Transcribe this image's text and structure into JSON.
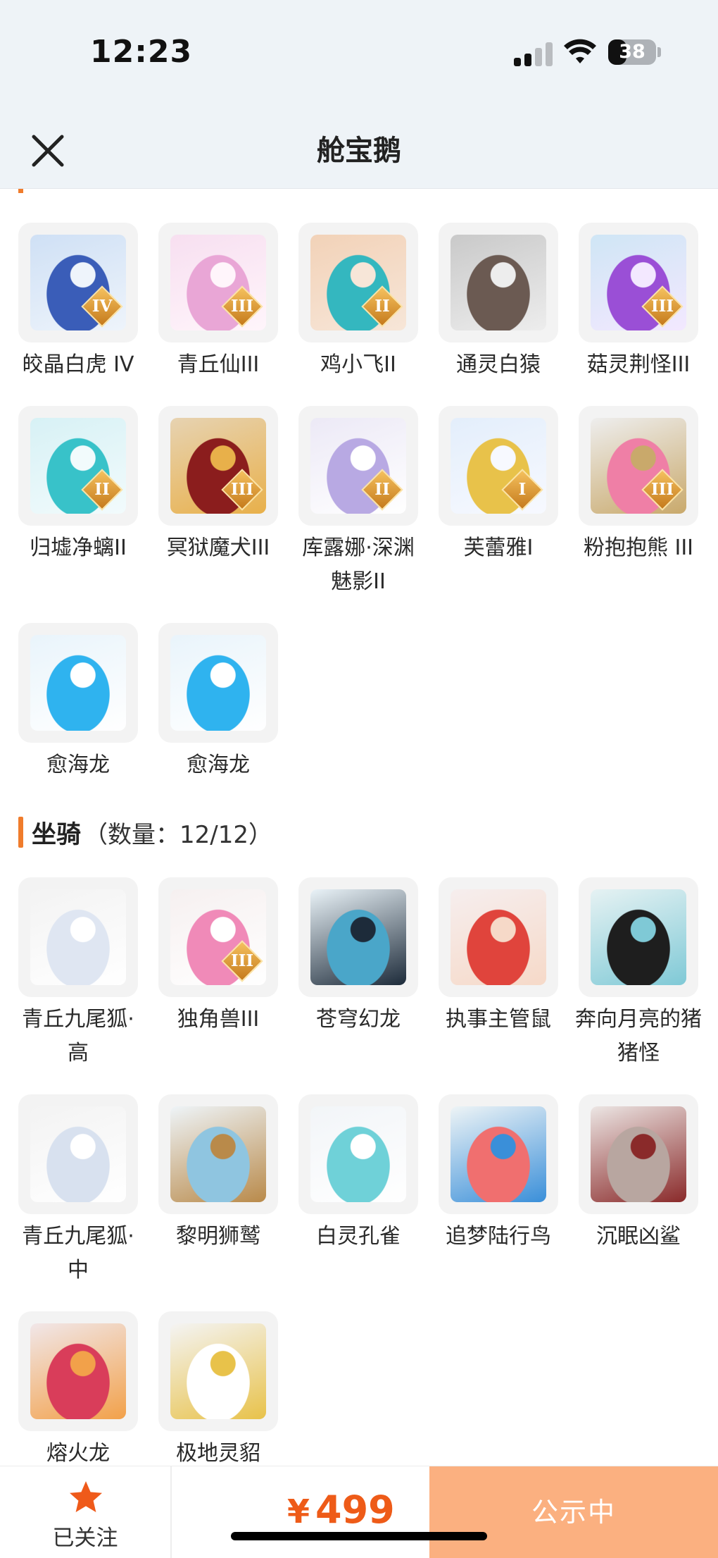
{
  "status_bar": {
    "time": "12:23",
    "battery": "38",
    "battery_level": 0.38
  },
  "nav": {
    "title": "舱宝鹅"
  },
  "pets": [
    {
      "name": "皎晶白虎 IV",
      "badge": "IV",
      "colors": [
        "#cfe0f5",
        "#3a5db8",
        "#eef4fb"
      ]
    },
    {
      "name": "青丘仙III",
      "badge": "III",
      "colors": [
        "#f7dff0",
        "#e9a6d6",
        "#fff5fb"
      ]
    },
    {
      "name": "鸡小飞II",
      "badge": "II",
      "colors": [
        "#f2d2b8",
        "#34b7bf",
        "#f7e6d8"
      ]
    },
    {
      "name": "通灵白猿",
      "badge": "",
      "colors": [
        "#c9c9c9",
        "#6b5a52",
        "#ededed"
      ]
    },
    {
      "name": "菇灵荆怪III",
      "badge": "III",
      "colors": [
        "#cfe6f5",
        "#9a4fd6",
        "#f3e8ff"
      ]
    },
    {
      "name": "归墟净螭II",
      "badge": "II",
      "colors": [
        "#d7f1f5",
        "#38c2c9",
        "#f2fbfc"
      ]
    },
    {
      "name": "冥狱魔犬III",
      "badge": "III",
      "colors": [
        "#e7d3b2",
        "#8b1d1d",
        "#e8b04a"
      ]
    },
    {
      "name": "库露娜·深渊魅影II",
      "badge": "II",
      "colors": [
        "#ece9f6",
        "#b8a9e3",
        "#ffffff"
      ]
    },
    {
      "name": "芙蕾雅I",
      "badge": "I",
      "colors": [
        "#e3eefb",
        "#e8c24a",
        "#f7f9ff"
      ]
    },
    {
      "name": "粉抱抱熊 III",
      "badge": "III",
      "colors": [
        "#eeeeee",
        "#ef7fa6",
        "#c9a96b"
      ]
    },
    {
      "name": "愈海龙",
      "badge": "",
      "colors": [
        "#e9f4fb",
        "#2fb3ef",
        "#ffffff"
      ]
    },
    {
      "name": "愈海龙",
      "badge": "",
      "colors": [
        "#e9f4fb",
        "#2fb3ef",
        "#ffffff"
      ]
    }
  ],
  "mount_section": {
    "title": "坐骑",
    "count_label": "（数量：12/12）"
  },
  "mounts": [
    {
      "name": "青丘九尾狐·高",
      "badge": "",
      "colors": [
        "#f3f3f3",
        "#dfe6f2",
        "#ffffff"
      ]
    },
    {
      "name": "独角兽III",
      "badge": "III",
      "colors": [
        "#f6f0f0",
        "#f08ab8",
        "#ffffff"
      ]
    },
    {
      "name": "苍穹幻龙",
      "badge": "",
      "colors": [
        "#eaf3f8",
        "#4aa6c9",
        "#1d2b3a"
      ]
    },
    {
      "name": "执事主管鼠",
      "badge": "",
      "colors": [
        "#f6eeee",
        "#e0443c",
        "#f6d9c8"
      ]
    },
    {
      "name": "奔向月亮的猪猪怪",
      "badge": "",
      "colors": [
        "#e6f2f3",
        "#1e1e1e",
        "#7fc9d6"
      ]
    },
    {
      "name": "青丘九尾狐·中",
      "badge": "",
      "colors": [
        "#f3f3f3",
        "#d8e1ef",
        "#ffffff"
      ]
    },
    {
      "name": "黎明狮鹫",
      "badge": "",
      "colors": [
        "#eef4f8",
        "#8fc5e0",
        "#b98a4a"
      ]
    },
    {
      "name": "白灵孔雀",
      "badge": "",
      "colors": [
        "#f2f5f8",
        "#6fd1d8",
        "#ffffff"
      ]
    },
    {
      "name": "追梦陆行鸟",
      "badge": "",
      "colors": [
        "#eef4f6",
        "#f06f6f",
        "#3a8fd9"
      ]
    },
    {
      "name": "沉眠凶鲨",
      "badge": "",
      "colors": [
        "#ece6e4",
        "#b8a6a0",
        "#8a2a2a"
      ]
    },
    {
      "name": "熔火龙",
      "badge": "",
      "colors": [
        "#f1e7e9",
        "#d93d5a",
        "#f2a14a"
      ]
    },
    {
      "name": "极地灵貂",
      "badge": "",
      "colors": [
        "#f4f4f4",
        "#ffffff",
        "#e8c24a"
      ]
    }
  ],
  "bottom_bar": {
    "follow_label": "已关注",
    "currency": "¥",
    "price": "499",
    "status_label": "公示中",
    "accent_color": "#ee5b18",
    "button_color": "#fbb080"
  }
}
